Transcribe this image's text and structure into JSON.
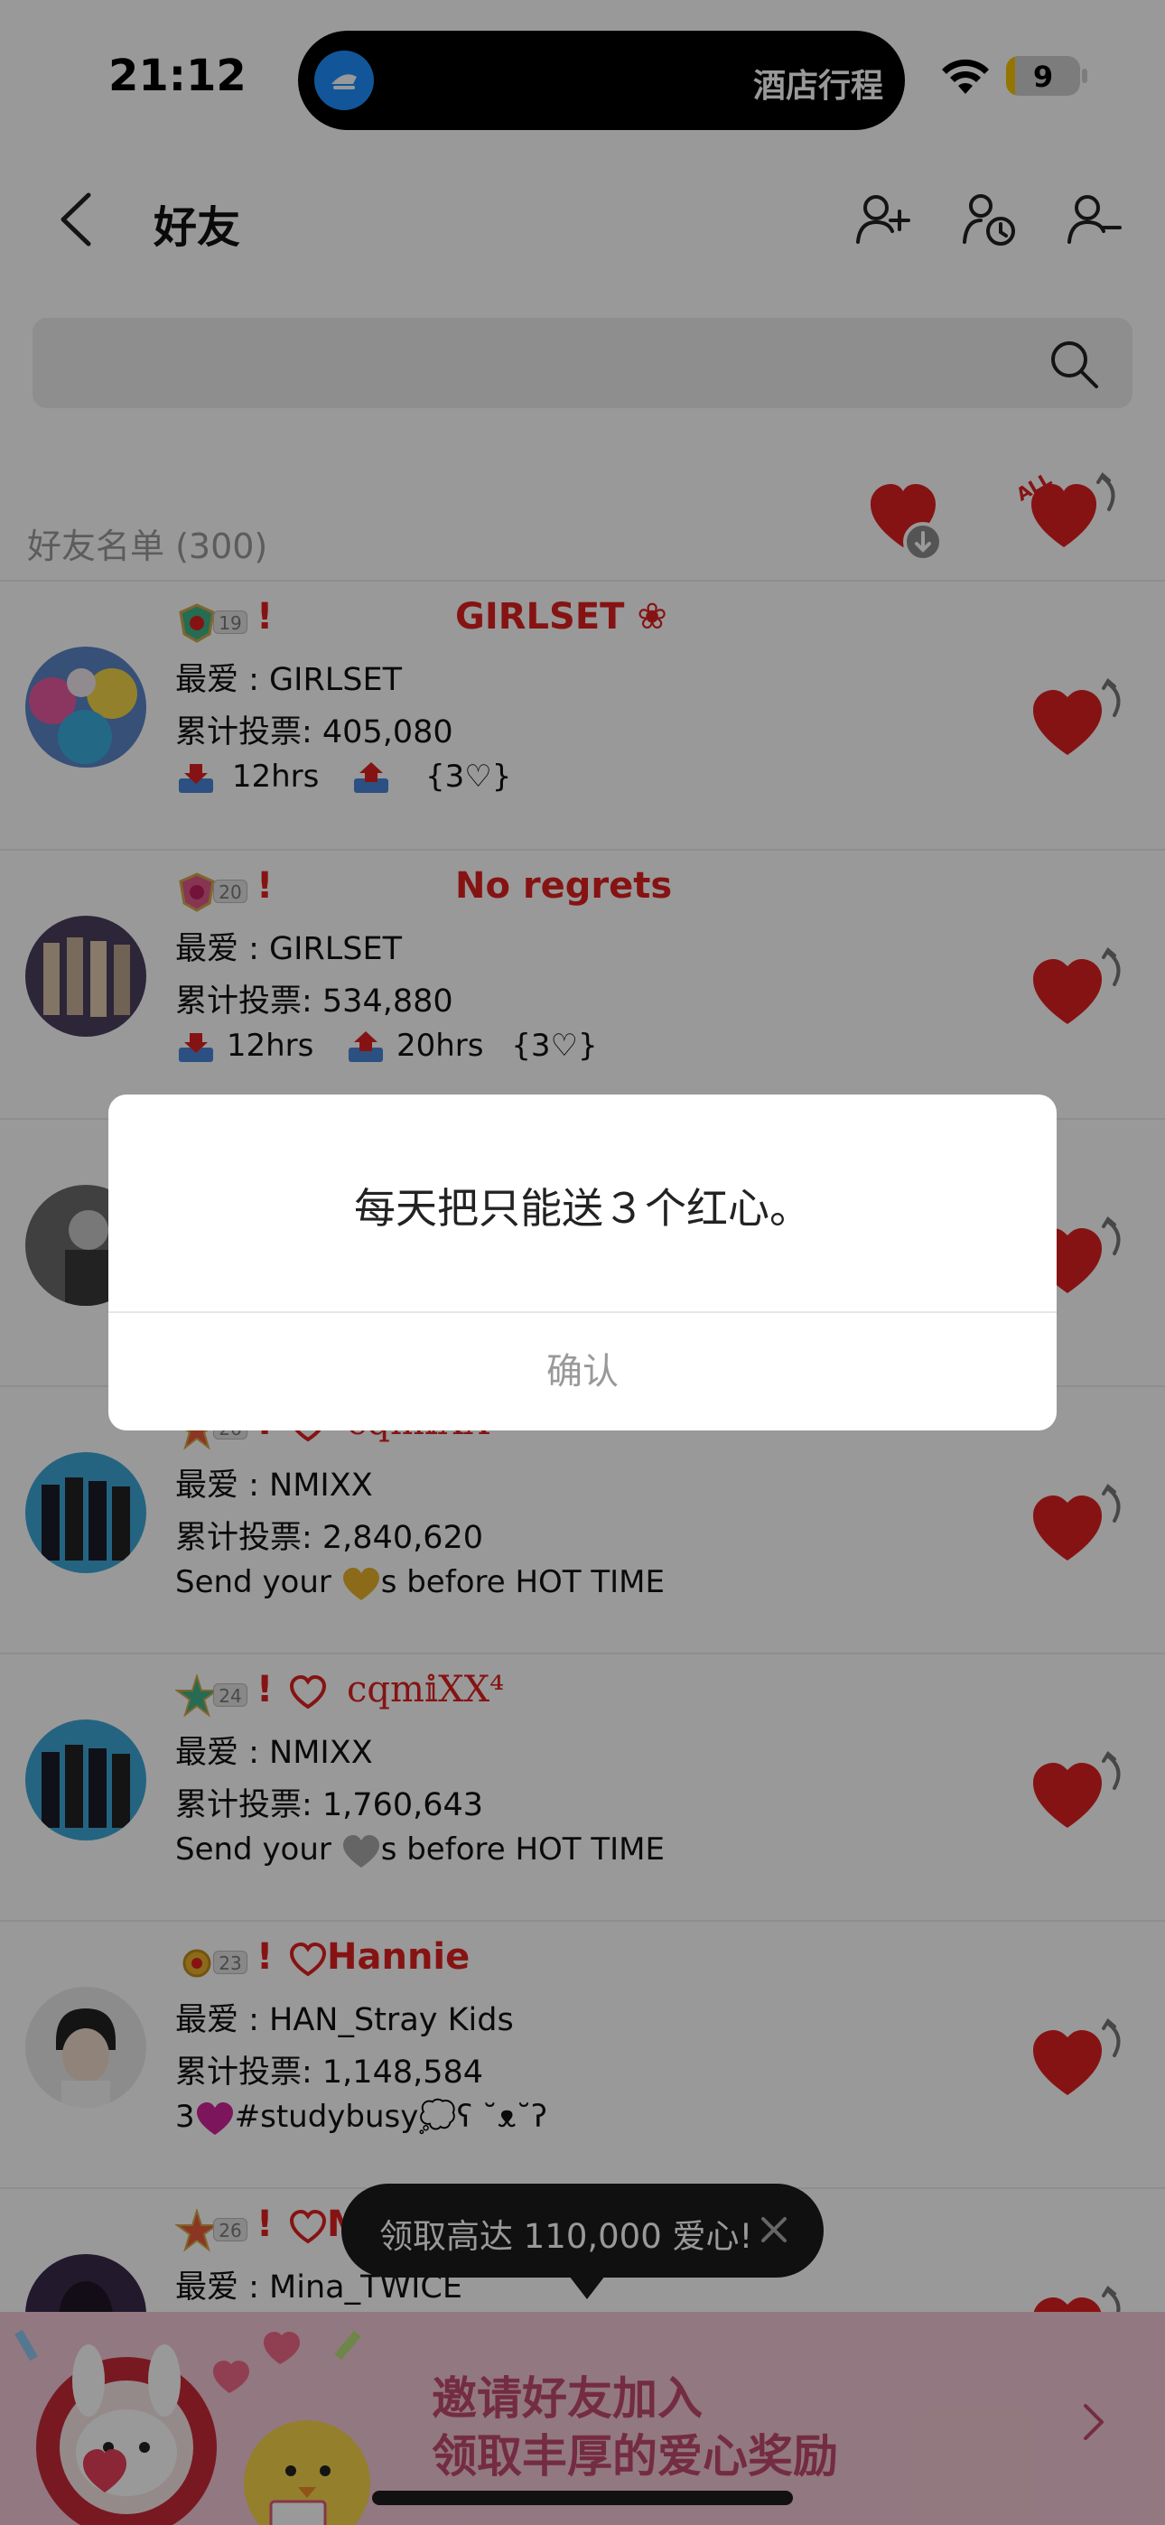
{
  "status_bar": {
    "time": "21:12",
    "island_text": "酒店行程",
    "battery": "9"
  },
  "nav": {
    "title": "好友",
    "icons": [
      "add-friend-icon",
      "friend-history-icon",
      "remove-friend-icon"
    ]
  },
  "search": {
    "placeholder": ""
  },
  "list": {
    "title": "好友名单 (300)"
  },
  "friends": [
    {
      "level": "19",
      "excl": "!",
      "nickname": "GIRLSET ❀",
      "favorite": "最爱 : GIRLSET",
      "votes": "累计投票: 405,080",
      "recv_time": "12hrs",
      "send_time": "",
      "tag": "{3♡}"
    },
    {
      "level": "20",
      "excl": "!",
      "nickname": "No regrets",
      "favorite": "最爱 : GIRLSET",
      "votes": "累计投票: 534,880",
      "recv_time": "12hrs",
      "send_time": "20hrs",
      "tag": "{3♡}"
    },
    {
      "level": "",
      "excl": "",
      "nickname": "",
      "favorite": "",
      "votes": "",
      "line3": ""
    },
    {
      "level": "26",
      "excl": "!",
      "nickname": "cqm𝕚XX²",
      "favorite": "最爱 : NMIXX",
      "votes": "累计投票: 2,840,620",
      "line3_pre": "Send your ",
      "line3_post": "s before HOT TIME"
    },
    {
      "level": "24",
      "excl": "!",
      "nickname": "cqm𝕚XX⁴",
      "favorite": "最爱 : NMIXX",
      "votes": "累计投票: 1,760,643",
      "line3_pre": "Send your ",
      "line3_post": "s before HOT TIME"
    },
    {
      "level": "23",
      "excl": "!",
      "nickname": "Hannie",
      "favorite": "最爱 : HAN_Stray Kids",
      "votes": "累计投票: 1,148,584",
      "line3_pre": "3",
      "line3_post": "#studybusy💭ʕ ˘ᴥ˘ʔ"
    },
    {
      "level": "26",
      "excl": "!",
      "nickname": "M",
      "favorite": "最爱 : Mina_TWICE",
      "votes": "",
      "line3": ""
    }
  ],
  "dialog": {
    "message": "每天把只能送３个红心。",
    "confirm": "确认"
  },
  "tooltip": {
    "text": "领取高达 110,000 爱心!"
  },
  "banner": {
    "line1": "邀请好友加入",
    "line2": "领取丰厚的爱心奖励"
  },
  "colors": {
    "accent_red": "#e02020",
    "banner_text": "#c24a6e",
    "banner_bg": "#f3c9d6"
  }
}
